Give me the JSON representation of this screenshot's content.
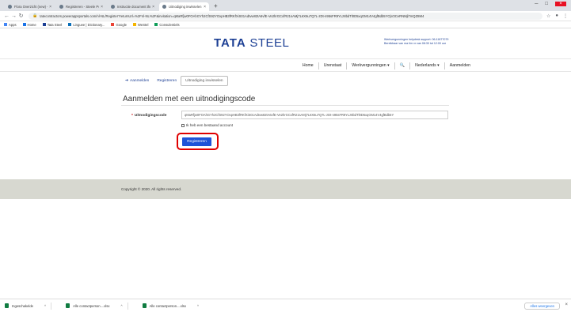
{
  "browser": {
    "tabs": [
      {
        "title": "Flora Overzicht (new) - Steele ...",
        "active": false
      },
      {
        "title": "Registreren - Steele Portal",
        "active": false
      },
      {
        "title": "Instructie document three portal",
        "active": false
      },
      {
        "title": "Uitnodiging inwisselen - Steele ...",
        "active": true
      }
    ],
    "new_tab": "+",
    "url": "tatecontractors.powerappsportals.com/nl-NL/Register?returnUrl=%2Fnl-NL%2F&invitation=qMaRfjw0FOAhGYh2CfS92YOxpHB3fRKfXiS01Adtvw82tA6vfE-Ve2hrGCxfR21sAMj7L€X6u7Q7L-zDt-n95sFR9YLz8bdTl0D5xqGM14V4gfBdb5YOjV3CeRNMjl7mQZ8M4",
    "bookmarks": [
      {
        "label": "Apps",
        "color": "#4285f4"
      },
      {
        "label": "Home",
        "color": "#1a73e8"
      },
      {
        "label": "Tata Steel",
        "color": "#1c3f94"
      },
      {
        "label": "Linguee | Dictionary...",
        "color": "#0b6fb8"
      },
      {
        "label": "Google",
        "color": "#ea4335"
      },
      {
        "label": "WeStel",
        "color": "#f4b400"
      },
      {
        "label": "Consulentiels",
        "color": "#0f9d58"
      }
    ]
  },
  "header": {
    "logo_bold": "TATA",
    "logo_rest": "STEEL",
    "helpdesk_line1": "Werkvergunningen helpdesk support: 06-11877079",
    "helpdesk_line2": "Bereikbaar van ma t/m vr van 08:30 tot 12:00 uur"
  },
  "nav": {
    "items": [
      "Home",
      "Urenstaat",
      "Werkvergunningen ▾",
      "🔍",
      "Nederlands ▾",
      "Aanmelden"
    ]
  },
  "subtabs": {
    "signin": "Aanmelden",
    "register": "Registreren",
    "redeem": "Uitnodiging inwisselen"
  },
  "form": {
    "heading": "Aanmelden met een uitnodigingscode",
    "code_label": "Uitnodigingscode",
    "code_value": "qMaRfjw0FOAhGYh2CfS92YOxpHB3fRKfXiS01Adtvw82tA6vfE-Ve2hrGCxfR21sAMj7L€X6u7Q7L-zDt-n95sFR9YLz8bdTl0D5xqGM14V4gfBdb5Y",
    "checkbox_label": "Ik heb een bestaand account",
    "submit_label": "Registreren"
  },
  "footer": {
    "copyright": "Copyright © 2020. All rights reserved."
  },
  "downloads": {
    "items": [
      "Ingeschakelde",
      "Alle contactperson....xlsx",
      "Alle contactperson....xlsx"
    ],
    "show_all": "Alles weergeven"
  }
}
